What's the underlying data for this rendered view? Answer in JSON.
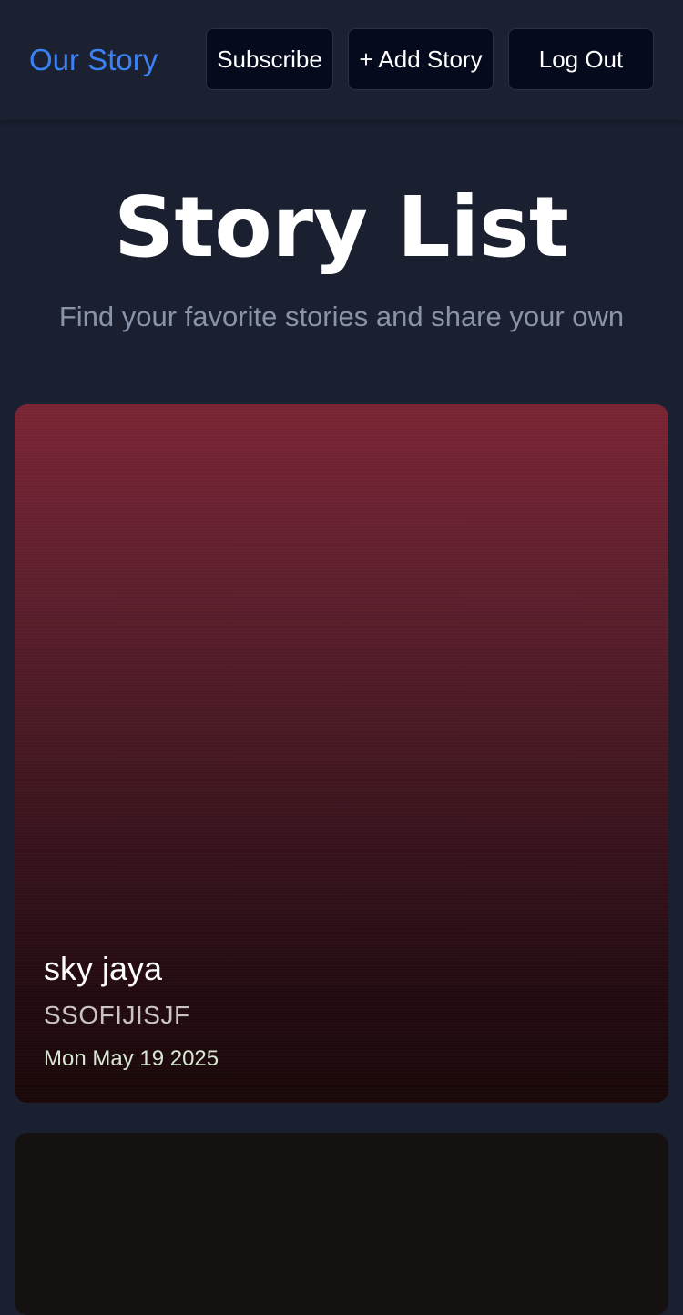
{
  "nav": {
    "brand": "Our Story",
    "subscribe_label": "Subscribe",
    "add_story_label": "+ Add Story",
    "logout_label": "Log Out"
  },
  "hero": {
    "title": "Story List",
    "subtitle": "Find your favorite stories and share your own"
  },
  "stories": [
    {
      "name": "sky jaya",
      "title": "SSOFIJISJF",
      "date": "Mon May 19 2025"
    }
  ],
  "colors": {
    "background": "#1a2030",
    "brand": "#3b82f6",
    "button_bg": "#050a1c",
    "card_top": "#7a2433",
    "card_bottom": "#1a0809"
  }
}
